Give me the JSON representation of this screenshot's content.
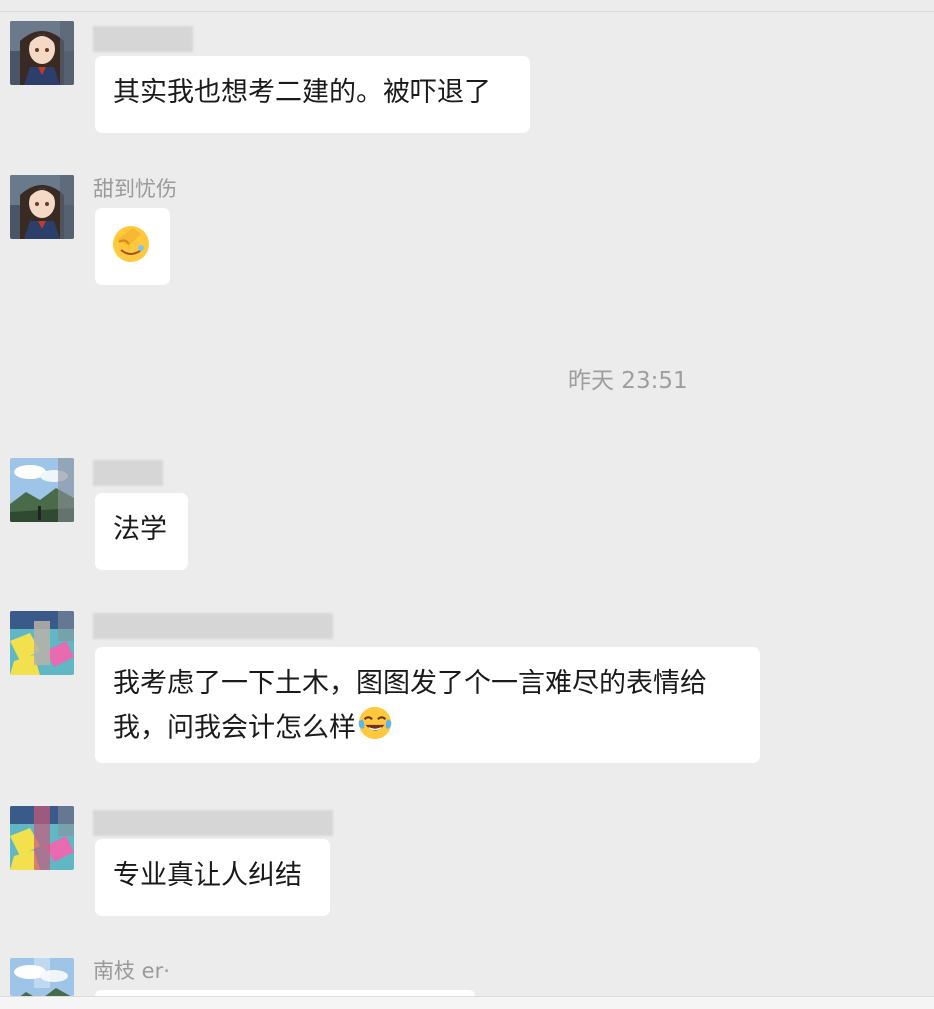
{
  "timestamp": "昨天 23:51",
  "messages": [
    {
      "sender": "",
      "text": "其实我也想考二建的。被吓退了"
    },
    {
      "sender": "甜到忧伤",
      "text": ""
    },
    {
      "sender": "",
      "text": "法学"
    },
    {
      "sender": "",
      "text": "我考虑了一下土木，图图发了个一言难尽的表情给我，问我会计怎么样"
    },
    {
      "sender": "",
      "text": "专业真让人纠结"
    },
    {
      "sender": "南枝 er·",
      "text": ""
    }
  ],
  "icons": [
    "anime-girl-avatar",
    "landscape-avatar",
    "colorful-room-avatar",
    "facepalm-emoji",
    "tears-of-joy-emoji"
  ]
}
